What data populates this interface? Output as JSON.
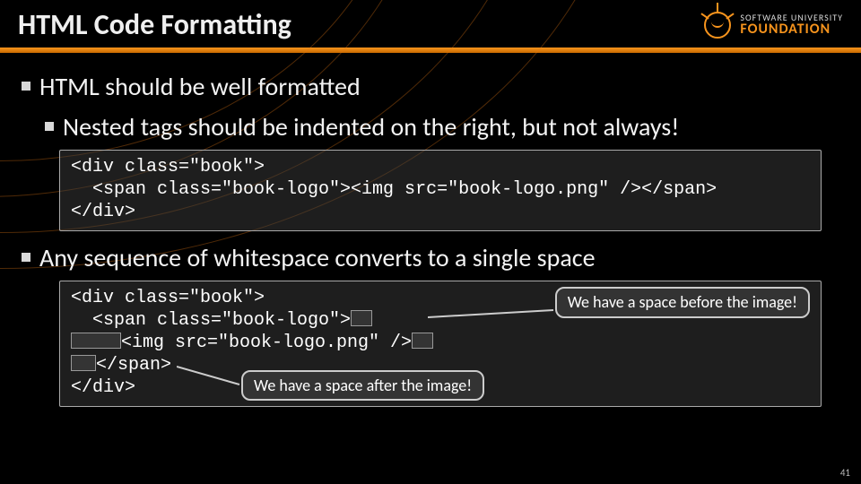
{
  "header": {
    "title": "HTML Code Formatting",
    "logo": {
      "line1": "SOFTWARE UNIVERSITY",
      "line2": "FOUNDATION"
    }
  },
  "bullets": {
    "b1": "HTML should be well formatted",
    "b2": "Nested tags should be indented on the right, but not always!",
    "b3": "Any sequence of whitespace converts to a single space"
  },
  "code1": {
    "l1": "<div class=\"book\">",
    "l2": "  <span class=\"book-logo\"><img src=\"book-logo.png\" /></span>",
    "l3": "</div>"
  },
  "code2": {
    "l1": "<div class=\"book\">",
    "l2_a": "  <span class=\"book-logo\">",
    "l3_a": "<img src=\"book-logo.png\" />",
    "l4_a": "</span>",
    "l5": "</div>"
  },
  "callouts": {
    "before": "We have a space before the image!",
    "after": "We have a space after the image!"
  },
  "page": "41"
}
